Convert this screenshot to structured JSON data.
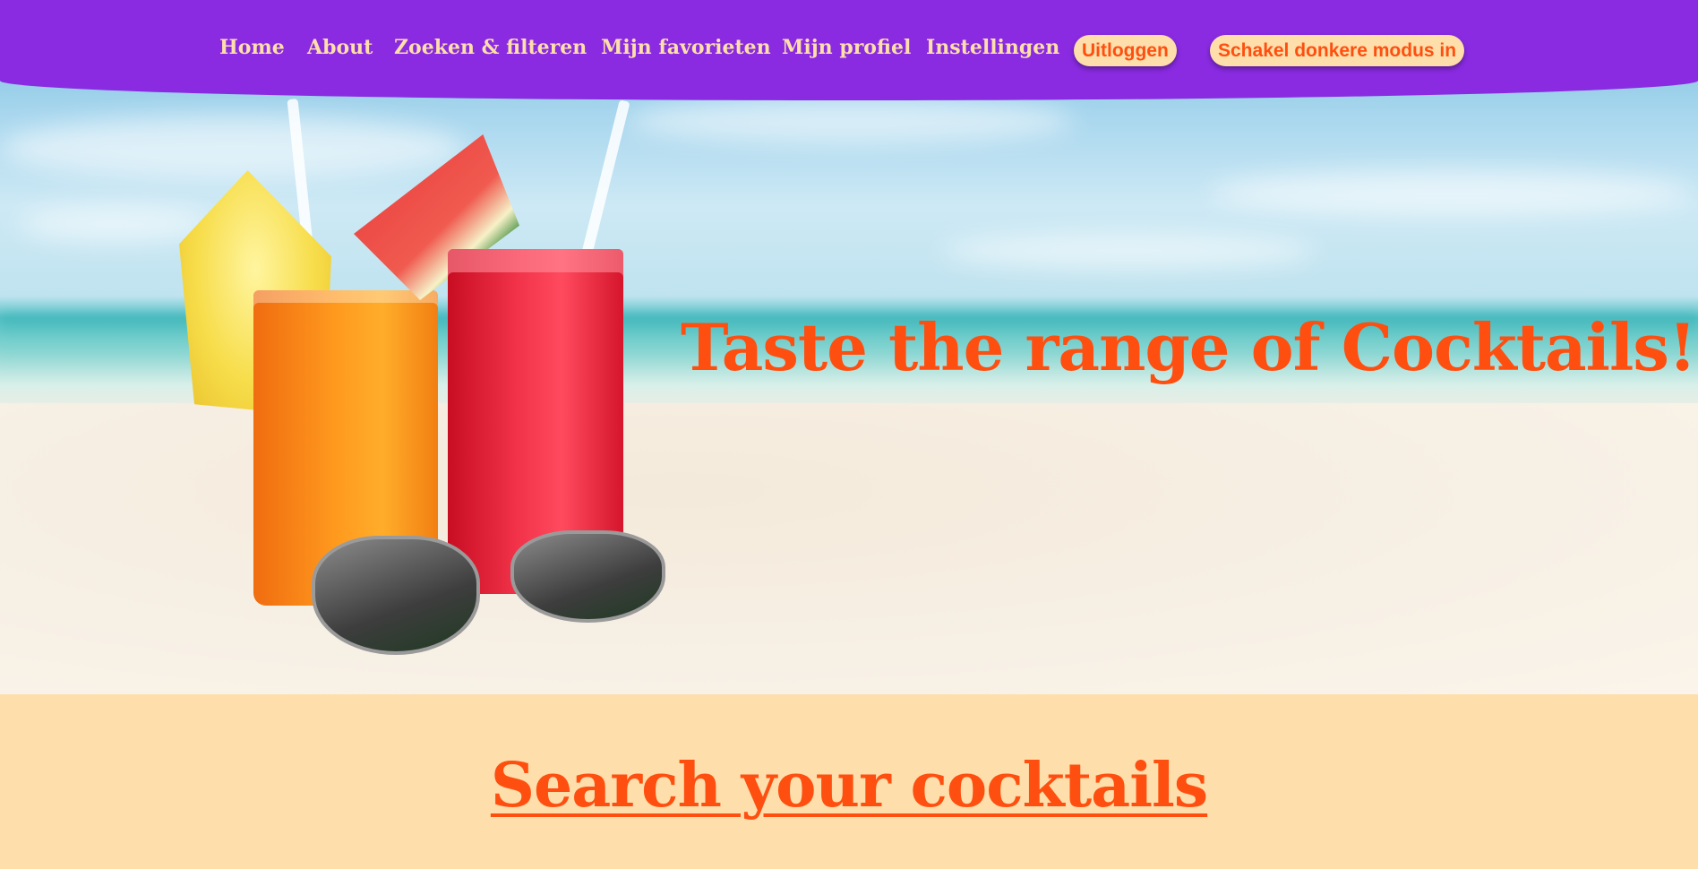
{
  "nav": {
    "items": [
      {
        "label": "Home"
      },
      {
        "label": "About"
      },
      {
        "label": "Zoeken & filteren"
      },
      {
        "label": "Mijn favorieten"
      },
      {
        "label": "Mijn profiel"
      },
      {
        "label": "Instellingen"
      }
    ],
    "logout_label": "Uitloggen",
    "dark_mode_label": "Schakel donkere modus in"
  },
  "hero": {
    "title": "Taste the range of Cocktails!",
    "image": "beach-cocktails-photo"
  },
  "search": {
    "heading": "Search your cocktails"
  },
  "colors": {
    "nav_bg": "#8a2be2",
    "nav_text": "#fedeaa",
    "accent": "#fe4f10",
    "cream": "#fedeaa"
  }
}
